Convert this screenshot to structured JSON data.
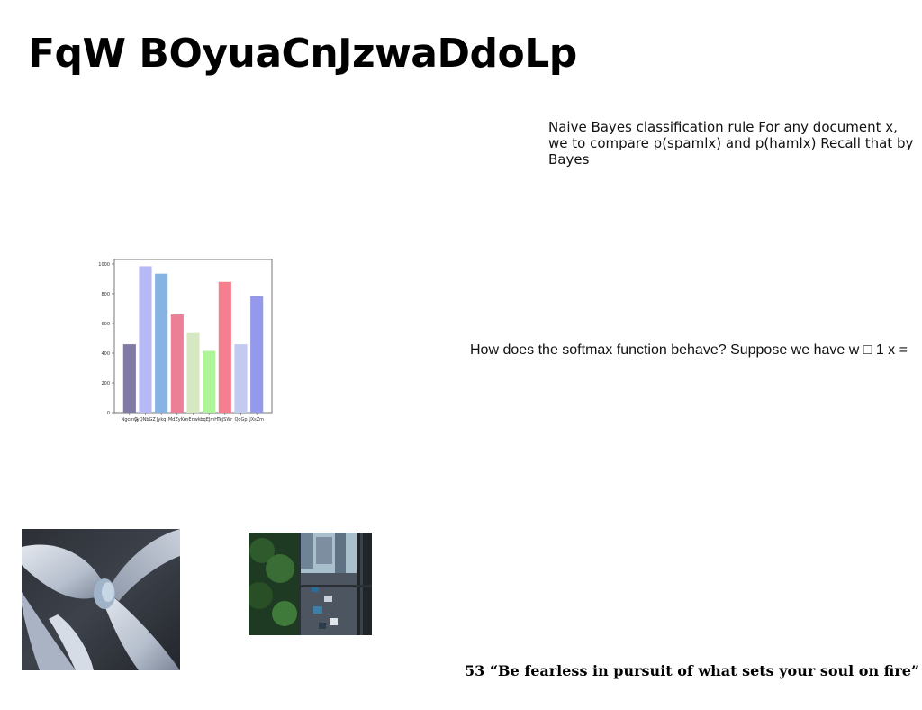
{
  "title": "FqW BOyuaCnJzwaDdoLp",
  "paragraph1": "Naive Bayes classification rule For any document x, we to compare p(spamlx) and p(hamlx) Recall that by Bayes",
  "paragraph2": "How does the softmax function behave? Suppose we have w □ 1 x =",
  "quote": "53 “Be fearless in pursuit of what sets your soul on fire”",
  "chart_data": {
    "type": "bar",
    "categories": [
      "NgcmG",
      "JyQNbGZ",
      "Jykq",
      "MdZyKe",
      "nEnwk",
      "bqEJmH",
      "TejSWr",
      "QoGp",
      "JXsZm"
    ],
    "values": [
      460,
      985,
      935,
      660,
      535,
      415,
      880,
      460,
      785
    ],
    "colors": [
      "#7f7aa6",
      "#b7b9f7",
      "#85b4e3",
      "#eb7f98",
      "#d5e8c2",
      "#aef59a",
      "#f57f8f",
      "#c3caf0",
      "#9499ec"
    ],
    "yticks": [
      "0",
      "200",
      "400",
      "600",
      "800",
      "1000"
    ],
    "ylim": [
      0,
      1030
    ],
    "title": "",
    "xlabel": "",
    "ylabel": ""
  },
  "images": {
    "abstract": "abstract-fan-blade-illustration",
    "window": "city-street-through-window-photo"
  }
}
